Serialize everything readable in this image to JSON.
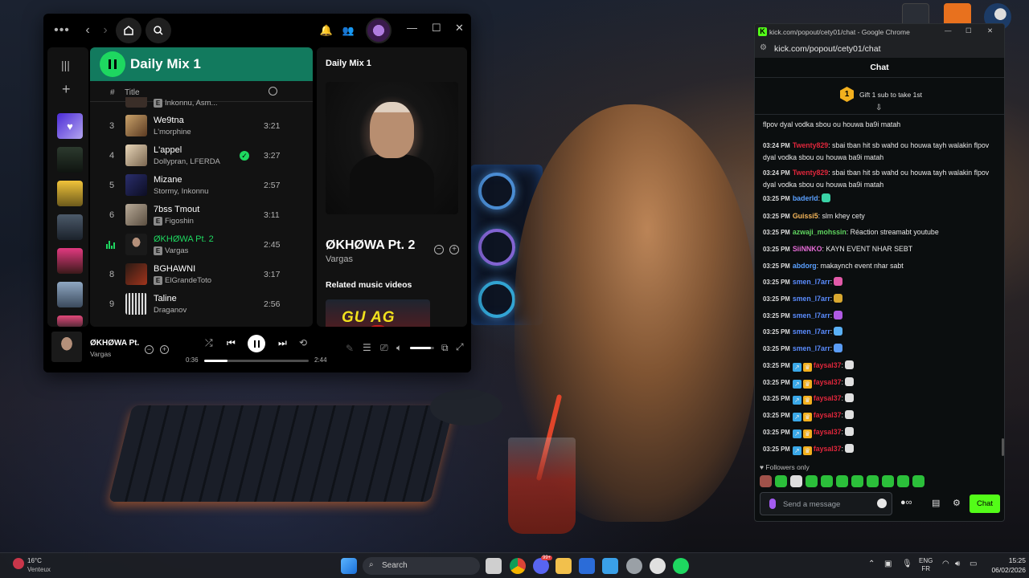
{
  "spotify": {
    "playlist_title": "Daily Mix 1",
    "col_title": "Title",
    "tracks": [
      {
        "num": "",
        "title": "",
        "artist": "Inkonnu, Asm...",
        "explicit": true,
        "duration": ""
      },
      {
        "num": "3",
        "title": "We9tna",
        "artist": "L'morphine",
        "explicit": false,
        "duration": "3:21"
      },
      {
        "num": "4",
        "title": "L'appel",
        "artist": "Dollypran, LFERDA",
        "explicit": false,
        "duration": "3:27",
        "saved": true
      },
      {
        "num": "5",
        "title": "Mizane",
        "artist": "Stormy, Inkonnu",
        "explicit": false,
        "duration": "2:57"
      },
      {
        "num": "6",
        "title": "7bss Tmout",
        "artist": "Figoshin",
        "explicit": true,
        "duration": "3:11"
      },
      {
        "num": "",
        "title": "ØKHØWA Pt. 2",
        "artist": "Vargas",
        "explicit": true,
        "duration": "2:45",
        "playing": true
      },
      {
        "num": "8",
        "title": "BGHAWNI",
        "artist": "ElGrandeToto",
        "explicit": true,
        "duration": "3:17"
      },
      {
        "num": "9",
        "title": "Taline",
        "artist": "Draganov",
        "explicit": false,
        "duration": "2:56"
      }
    ],
    "now_playing_panel": {
      "header": "Daily Mix 1",
      "title": "ØKHØWA Pt. 2",
      "artist": "Vargas",
      "related_heading": "Related music videos",
      "related_thumb_text": "GU AG"
    },
    "player": {
      "title": "ØKHØWA Pt.",
      "artist": "Vargas",
      "elapsed": "0:36",
      "total": "2:44",
      "progress": 0.22,
      "volume": 0.85
    }
  },
  "chrome": {
    "window_title": "kick.com/popout/cety01/chat - Google Chrome",
    "url": "kick.com/popout/cety01/chat",
    "chat_header": "Chat",
    "gift_badge": "1",
    "gift_text": "Gift 1 sub to take 1st",
    "messages": [
      {
        "time": "",
        "user": "",
        "user_color": "#e8e8e8",
        "text": "flpov dyal vodka sbou ou houwa ba9i matah"
      },
      {
        "time": "03:24 PM",
        "user": "Twenty829",
        "user_color": "#e0263b",
        "text": ": sbai tban hit sb wahd ou houwa tayh walakin flpov dyal vodka sbou ou houwa ba9i matah"
      },
      {
        "time": "03:24 PM",
        "user": "Twenty829",
        "user_color": "#e0263b",
        "text": ": sbai tban hit sb wahd ou houwa tayh walakin flpov dyal vodka sbou ou houwa ba9i matah"
      },
      {
        "time": "03:25 PM",
        "user": "baderld",
        "user_color": "#5aa0ff",
        "text": ":",
        "emote": "#3ad3a6"
      },
      {
        "time": "03:25 PM",
        "user": "Guissi5",
        "user_color": "#f5b65a",
        "text": ": slm khey cety"
      },
      {
        "time": "03:25 PM",
        "user": "azwaji_mohssin",
        "user_color": "#5fd35f",
        "text": ": Réaction streamabt youtube"
      },
      {
        "time": "03:25 PM",
        "user": "SiiNNKO",
        "user_color": "#e56bd6",
        "text": ": KAYN EVENT NHAR SEBT"
      },
      {
        "time": "03:25 PM",
        "user": "abdorg",
        "user_color": "#5aa0ff",
        "text": ": makaynch event nhar sabt"
      },
      {
        "time": "03:25 PM",
        "user": "smen_l7arr",
        "user_color": "#5a8cff",
        "text": ":",
        "emote": "#e25aa8"
      },
      {
        "time": "03:25 PM",
        "user": "smen_l7arr",
        "user_color": "#5a8cff",
        "text": ":",
        "emote": "#d9a830"
      },
      {
        "time": "03:25 PM",
        "user": "smen_l7arr",
        "user_color": "#5a8cff",
        "text": ":",
        "emote": "#b05ae2"
      },
      {
        "time": "03:25 PM",
        "user": "smen_l7arr",
        "user_color": "#5a8cff",
        "text": ":",
        "emote": "#5ab0f5"
      },
      {
        "time": "03:25 PM",
        "user": "smen_l7arr",
        "user_color": "#5a8cff",
        "text": ":",
        "emote": "#5a9cf5"
      },
      {
        "time": "03:25 PM",
        "user": "faysal37",
        "user_color": "#e0263b",
        "text": ":",
        "emote": "#e0e0e0",
        "badges": true
      },
      {
        "time": "03:25 PM",
        "user": "faysal37",
        "user_color": "#e0263b",
        "text": ":",
        "emote": "#e0e0e0",
        "badges": true
      },
      {
        "time": "03:25 PM",
        "user": "faysal37",
        "user_color": "#e0263b",
        "text": ":",
        "emote": "#e0e0e0",
        "badges": true
      },
      {
        "time": "03:25 PM",
        "user": "faysal37",
        "user_color": "#e0263b",
        "text": ":",
        "emote": "#e0e0e0",
        "badges": true
      },
      {
        "time": "03:25 PM",
        "user": "faysal37",
        "user_color": "#e0263b",
        "text": ":",
        "emote": "#e0e0e0",
        "badges": true
      },
      {
        "time": "03:25 PM",
        "user": "faysal37",
        "user_color": "#e0263b",
        "text": ":",
        "emote": "#e0e0e0",
        "badges": true
      }
    ],
    "followers_only": "Followers only",
    "input_placeholder": "Send a message",
    "send_label": "Chat"
  },
  "taskbar": {
    "weather_temp": "16°C",
    "weather_text": "Venteux",
    "search_placeholder": "Search",
    "lang_top": "ENG",
    "lang_bottom": "FR",
    "time": "15:25",
    "date": "06/02/2026",
    "badge_count": "99+"
  },
  "colors": {
    "spotify_green": "#1ed760",
    "kick_green": "#53fc18",
    "header_teal": "#127a5e"
  }
}
